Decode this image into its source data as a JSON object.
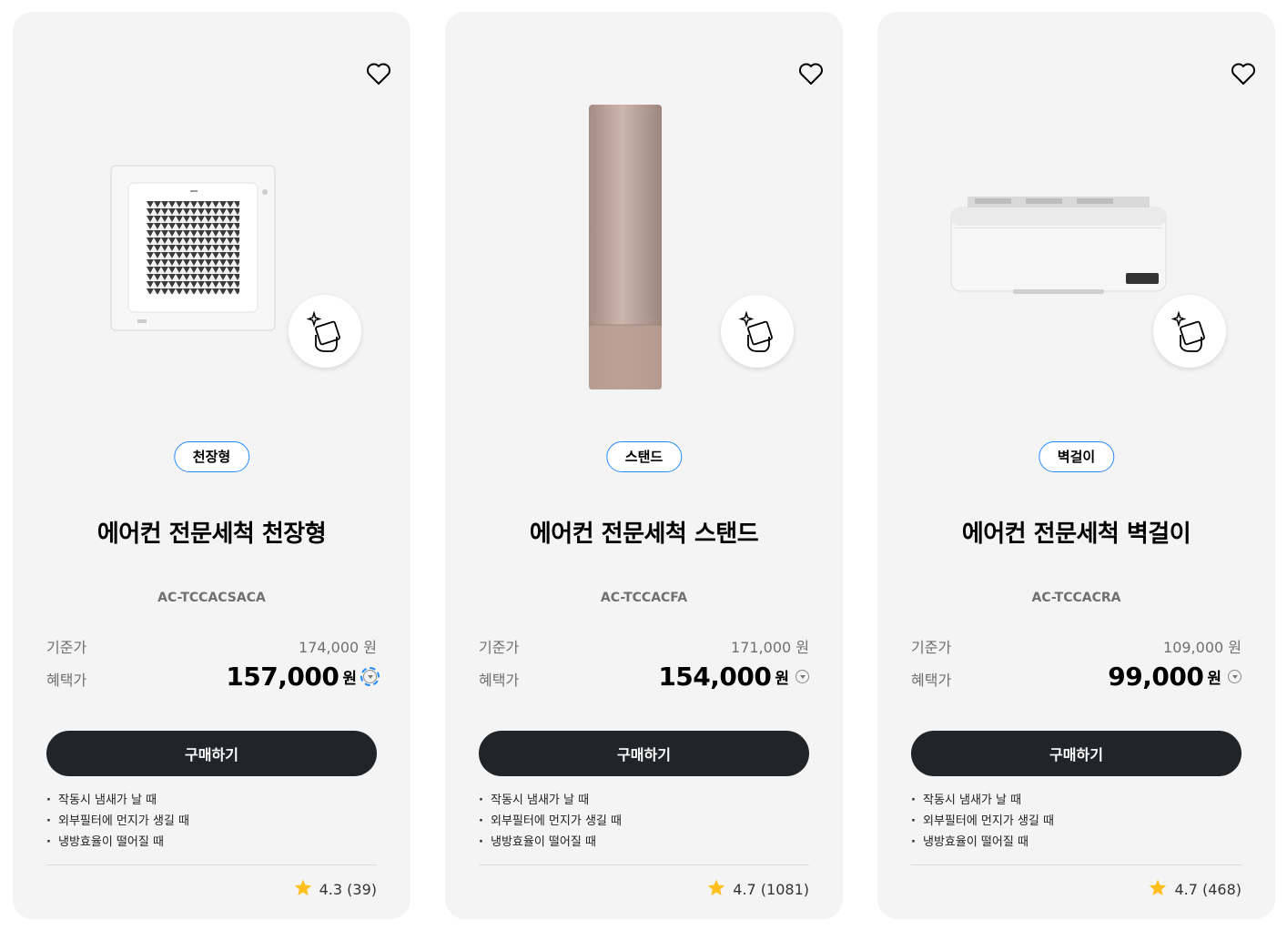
{
  "colors": {
    "accent": "#2189ff",
    "star": "#ffc01f",
    "button_bg": "#222528",
    "card_bg": "#f4f4f4"
  },
  "icons": {
    "wishlist": "heart-outline-icon",
    "cleaning": "cleaning-hand-sparkle-icon",
    "info": "chevron-down-circle-icon",
    "rating": "star-icon"
  },
  "products": [
    {
      "tag": "천장형",
      "title": "에어컨 전문세척 천장형",
      "model": "AC-TCCACSACA",
      "standard_label": "기준가",
      "standard_price": "174,000 원",
      "benefit_label": "혜택가",
      "benefit_price": "157,000",
      "currency": "원",
      "buy_label": "구매하기",
      "features": [
        "작동시 냄새가 날 때",
        "외부필터에 먼지가 생길 때",
        "냉방효율이 떨어질 때"
      ],
      "rating": "4.3 (39)"
    },
    {
      "tag": "스탠드",
      "title": "에어컨 전문세척 스탠드",
      "model": "AC-TCCACFA",
      "standard_label": "기준가",
      "standard_price": "171,000 원",
      "benefit_label": "혜택가",
      "benefit_price": "154,000",
      "currency": "원",
      "buy_label": "구매하기",
      "features": [
        "작동시 냄새가 날 때",
        "외부필터에 먼지가 생길 때",
        "냉방효율이 떨어질 때"
      ],
      "rating": "4.7 (1081)"
    },
    {
      "tag": "벽걸이",
      "title": "에어컨 전문세척 벽걸이",
      "model": "AC-TCCACRA",
      "standard_label": "기준가",
      "standard_price": "109,000 원",
      "benefit_label": "혜택가",
      "benefit_price": "99,000",
      "currency": "원",
      "buy_label": "구매하기",
      "features": [
        "작동시 냄새가 날 때",
        "외부필터에 먼지가 생길 때",
        "냉방효율이 떨어질 때"
      ],
      "rating": "4.7 (468)"
    }
  ]
}
